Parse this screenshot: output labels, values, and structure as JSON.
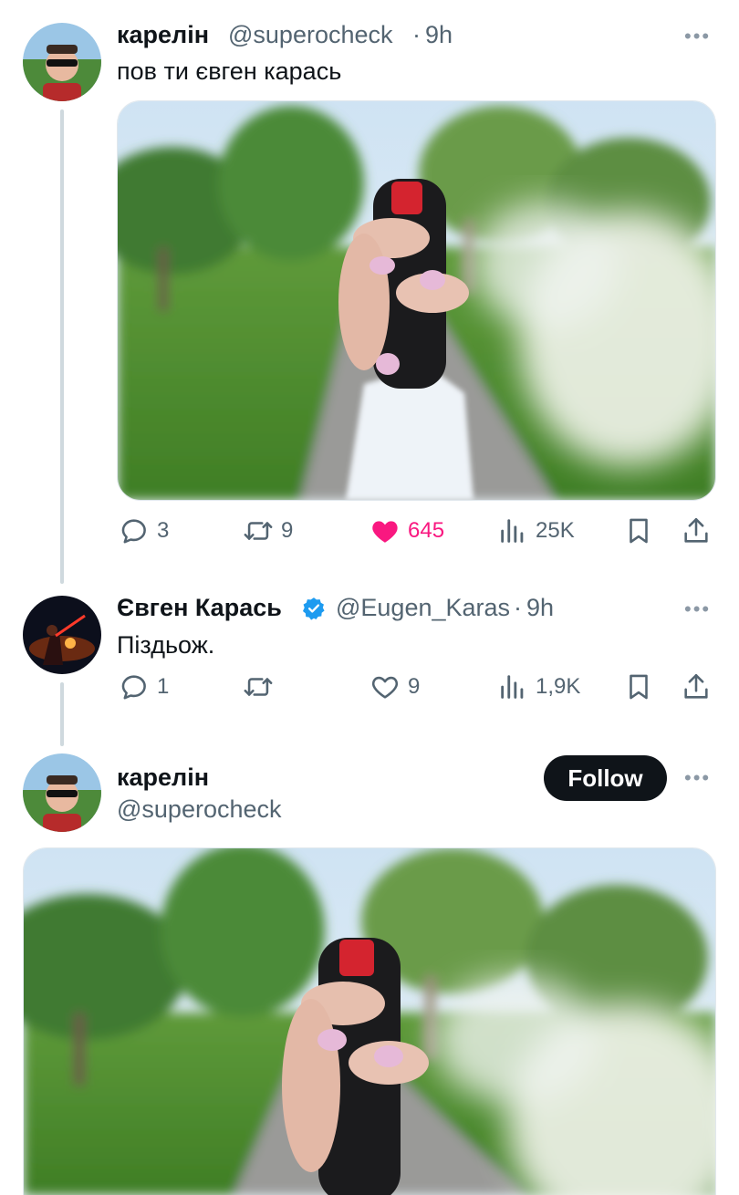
{
  "tweet1": {
    "name": "карелін",
    "handle": "@superocheck",
    "time": "9h",
    "text": "пов ти євген карась",
    "actions": {
      "replies": "3",
      "reposts": "9",
      "likes": "645",
      "views": "25K"
    },
    "liked": true
  },
  "tweet2": {
    "name": "Євген Карась",
    "handle": "@Eugen_Karas",
    "time": "9h",
    "text": "Піздьож.",
    "actions": {
      "replies": "1",
      "reposts": "",
      "likes": "9",
      "views": "1,9K"
    },
    "verified": true
  },
  "tweet3": {
    "name": "карелін",
    "handle": "@superocheck",
    "follow_label": "Follow"
  },
  "separator": "·",
  "more_label": "•••",
  "colors": {
    "like_active": "#f91880",
    "verified_blue": "#1d9bf0",
    "text_secondary": "#536471"
  },
  "icons": [
    "reply-icon",
    "repost-icon",
    "like-icon",
    "views-icon",
    "bookmark-icon",
    "share-icon",
    "more-icon",
    "verified-badge-icon"
  ]
}
